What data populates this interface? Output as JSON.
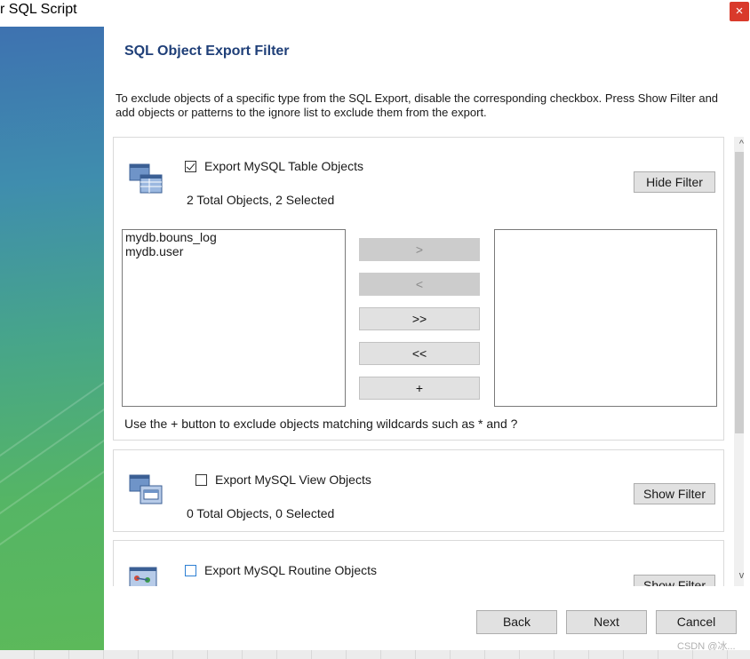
{
  "window": {
    "title": "r SQL Script",
    "close_glyph": "×"
  },
  "page": {
    "title": "SQL Object Export Filter",
    "description": "To exclude objects of a specific type from the SQL Export, disable the corresponding checkbox. Press Show Filter and add objects or patterns to the ignore list to exclude them from the export."
  },
  "sections": [
    {
      "checkbox_label": "Export MySQL Table Objects",
      "checked": true,
      "count_text": "2 Total Objects, 2 Selected",
      "filter_button": "Hide Filter",
      "icon": "table-objects-icon",
      "available_items": [
        "mydb.bouns_log",
        "mydb.user"
      ],
      "movers": [
        {
          "label": ">",
          "enabled": false
        },
        {
          "label": "<",
          "enabled": false
        },
        {
          "label": ">>",
          "enabled": true
        },
        {
          "label": "<<",
          "enabled": true
        },
        {
          "label": "+",
          "enabled": true
        }
      ],
      "hint": "Use the + button to exclude objects matching wildcards such as * and ?"
    },
    {
      "checkbox_label": "Export MySQL View Objects",
      "checked": false,
      "count_text": "0 Total Objects, 0 Selected",
      "filter_button": "Show Filter",
      "icon": "view-objects-icon"
    },
    {
      "checkbox_label": "Export MySQL Routine Objects",
      "checked": false,
      "filter_button": "Show Filter",
      "icon": "routine-objects-icon"
    }
  ],
  "scrollbar": {
    "up_glyph": "^",
    "down_glyph": "v"
  },
  "footer": {
    "back": "Back",
    "next": "Next",
    "cancel": "Cancel"
  },
  "watermark": "CSDN @冰...",
  "colors": {
    "title_blue": "#1f3f78",
    "close_red": "#d93a2b",
    "sidebar_top": "#3e72b0",
    "sidebar_bottom": "#5cb95a"
  }
}
